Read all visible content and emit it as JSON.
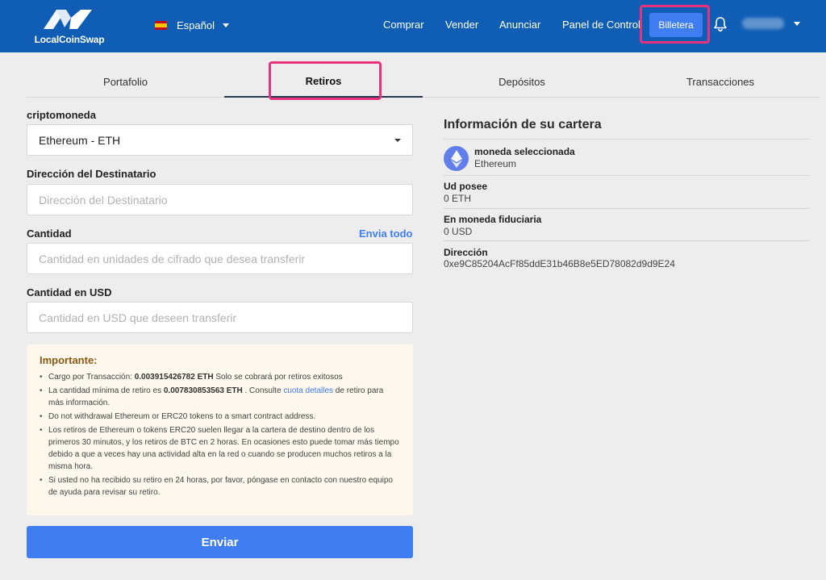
{
  "header": {
    "logo_text": "LocalCoinSwap",
    "language": "Español",
    "nav": [
      "Comprar",
      "Vender",
      "Anunciar",
      "Panel de Control"
    ],
    "wallet_button": "Billetera",
    "colors": {
      "bar": "#0f5db5",
      "accent": "#3f7df3",
      "highlight": "#e8327d"
    }
  },
  "tabs": [
    "Portafolio",
    "Retiros",
    "Depósitos",
    "Transacciones"
  ],
  "form": {
    "crypto_label": "criptomoneda",
    "crypto_value": "Ethereum - ETH",
    "address_label": "Dirección del Destinatario",
    "address_placeholder": "Dirección del Destinatario",
    "amount_label": "Cantidad",
    "send_all": "Envia todo",
    "amount_placeholder": "Cantidad en unidades de cifrado que desea transferir",
    "usd_label": "Cantidad en USD",
    "usd_placeholder": "Cantidad en USD que deseen transferir",
    "submit": "Enviar"
  },
  "notice": {
    "title": "Importante:",
    "fee_prefix": "Cargo por Transacción: ",
    "fee_value": "0.003915426782 ETH",
    "fee_suffix": " Solo se cobrará por retiros exitosos",
    "min_prefix": "La cantidad mínima de retiro es ",
    "min_value": "0.007830853563 ETH",
    "min_middle": " . Consulte ",
    "min_link": "cuota detalles",
    "min_suffix": " de retiro para más información.",
    "item3": "Do not withdrawal Ethereum or ERC20 tokens to a smart contract address.",
    "item4": "Los retiros de Ethereum o tokens ERC20 suelen llegar a la cartera de destino dentro de los primeros 30 minutos, y los retiros de BTC en 2 horas. En ocasiones esto puede tomar más tiempo debido a que a veces hay una actividad alta en la red o cuando se producen muchos retiros a la misma hora.",
    "item5": "Si usted no ha recibido su retiro en 24 horas, por favor, póngase en contacto con nuestro equipo de ayuda para revisar su retiro."
  },
  "wallet_info": {
    "title": "Información de su cartera",
    "selected_label": "moneda seleccionada",
    "selected_value": "Ethereum",
    "holdings_label": "Ud posee",
    "holdings_value": "0 ETH",
    "fiat_label": "En moneda fiduciaria",
    "fiat_value": "0 USD",
    "address_label": "Dirección",
    "address_value": "0xe9C85204AcFf85ddE31b46B8e5ED78082d9d9E24"
  }
}
